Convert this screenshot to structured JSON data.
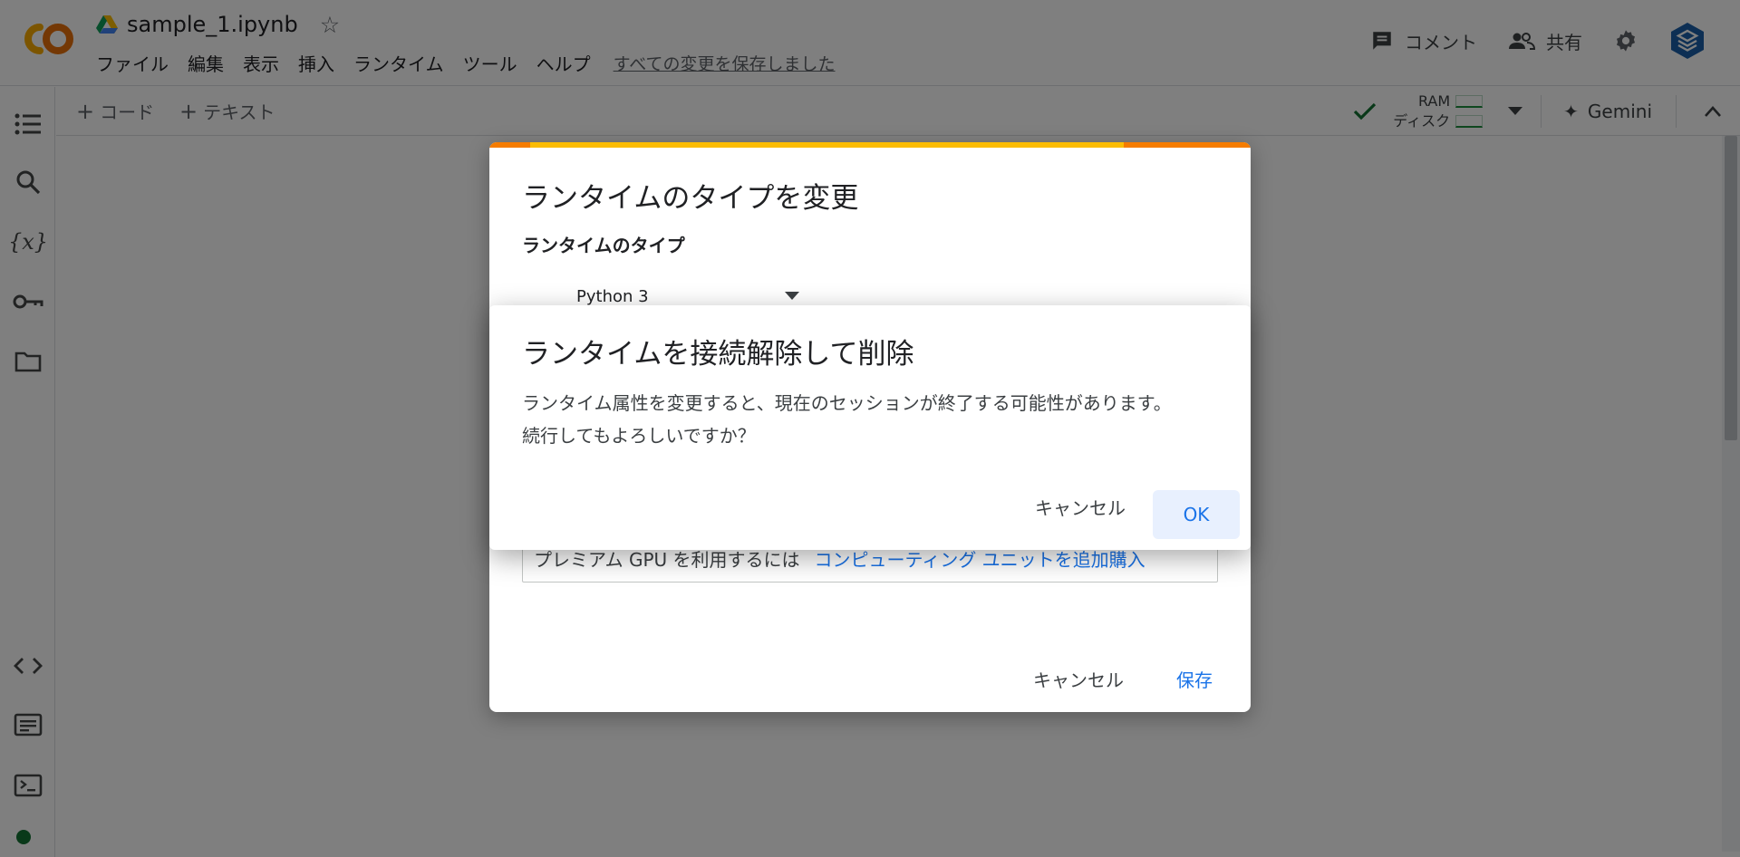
{
  "header": {
    "file_name": "sample_1.ipynb",
    "menu": [
      "ファイル",
      "編集",
      "表示",
      "挿入",
      "ランタイム",
      "ツール",
      "ヘルプ"
    ],
    "saved_status": "すべての変更を保存しました",
    "comment_label": "コメント",
    "share_label": "共有",
    "icons": [
      "colab-logo-icon",
      "drive-icon",
      "star-icon",
      "comment-icon",
      "people-icon",
      "gear-icon",
      "brand-icon"
    ]
  },
  "toolbar": {
    "add_code": "コード",
    "add_text": "テキスト",
    "ram_label": "RAM",
    "disk_label": "ディスク",
    "gemini_label": "Gemini"
  },
  "colors": {
    "accent": "#1a73e8",
    "progress_orange": "#f57c00",
    "progress_yellow": "#fbbc04",
    "connected_green": "#137333"
  },
  "back_dialog": {
    "title": "ランタイムのタイプを変更",
    "runtime_type_label": "ランタイムのタイプ",
    "runtime_value": "Python 3",
    "info_text": "プレミアム GPU を利用するには",
    "info_link": "コンピューティング ユニットを追加購入",
    "cancel_label": "キャンセル",
    "save_label": "保存"
  },
  "front_dialog": {
    "title": "ランタイムを接続解除して削除",
    "message_line1": "ランタイム属性を変更すると、現在のセッションが終了する可能性があります。",
    "message_line2": "続行してもよろしいですか？",
    "cancel_label": "キャンセル",
    "ok_label": "OK"
  }
}
